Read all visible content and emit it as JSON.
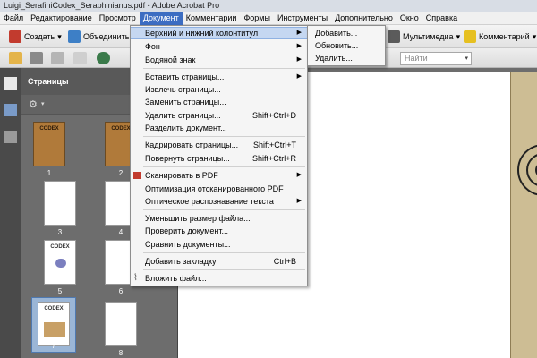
{
  "window": {
    "title": "Luigi_SerafiniCodex_Seraphinianus.pdf - Adobe Acrobat Pro"
  },
  "menubar": {
    "items": [
      "Файл",
      "Редактирование",
      "Просмотр",
      "Документ",
      "Комментарии",
      "Формы",
      "Инструменты",
      "Дополнительно",
      "Окно",
      "Справка"
    ],
    "active": "Документ"
  },
  "toolbar1": {
    "create_label": "Создать",
    "combine_label": "Объединить",
    "multimedia_label": "Мультимедиа",
    "comment_label": "Комментарий"
  },
  "search": {
    "placeholder": "Найти"
  },
  "pages_panel": {
    "title": "Страницы",
    "thumb_labels": [
      "1",
      "2",
      "3",
      "4",
      "5",
      "6",
      "7",
      "8"
    ],
    "codex_text": "CODEX"
  },
  "document_menu": {
    "items": [
      {
        "label": "Верхний и нижний колонтитул",
        "shortcut": ""
      },
      {
        "label": "Фон",
        "shortcut": ""
      },
      {
        "label": "Водяной знак",
        "shortcut": ""
      },
      {
        "label": "Вставить страницы...",
        "shortcut": ""
      },
      {
        "label": "Извлечь страницы...",
        "shortcut": ""
      },
      {
        "label": "Заменить страницы...",
        "shortcut": ""
      },
      {
        "label": "Удалить страницы...",
        "shortcut": "Shift+Ctrl+D"
      },
      {
        "label": "Разделить документ...",
        "shortcut": ""
      },
      {
        "label": "Кадрировать страницы...",
        "shortcut": "Shift+Ctrl+T"
      },
      {
        "label": "Повернуть страницы...",
        "shortcut": "Shift+Ctrl+R"
      },
      {
        "label": "Сканировать в PDF",
        "shortcut": ""
      },
      {
        "label": "Оптимизация отсканированного PDF",
        "shortcut": ""
      },
      {
        "label": "Оптическое распознавание текста",
        "shortcut": ""
      },
      {
        "label": "Уменьшить размер файла...",
        "shortcut": ""
      },
      {
        "label": "Проверить документ...",
        "shortcut": ""
      },
      {
        "label": "Сравнить документы...",
        "shortcut": ""
      },
      {
        "label": "Добавить закладку",
        "shortcut": "Ctrl+B"
      },
      {
        "label": "Вложить файл...",
        "shortcut": ""
      }
    ]
  },
  "header_footer_submenu": {
    "items": [
      "Добавить...",
      "Обновить...",
      "Удалить..."
    ]
  },
  "colors": {
    "menu_highlight": "#c5d7f1",
    "menubar_active": "#3c6dc2",
    "panel_dark": "#595959"
  }
}
